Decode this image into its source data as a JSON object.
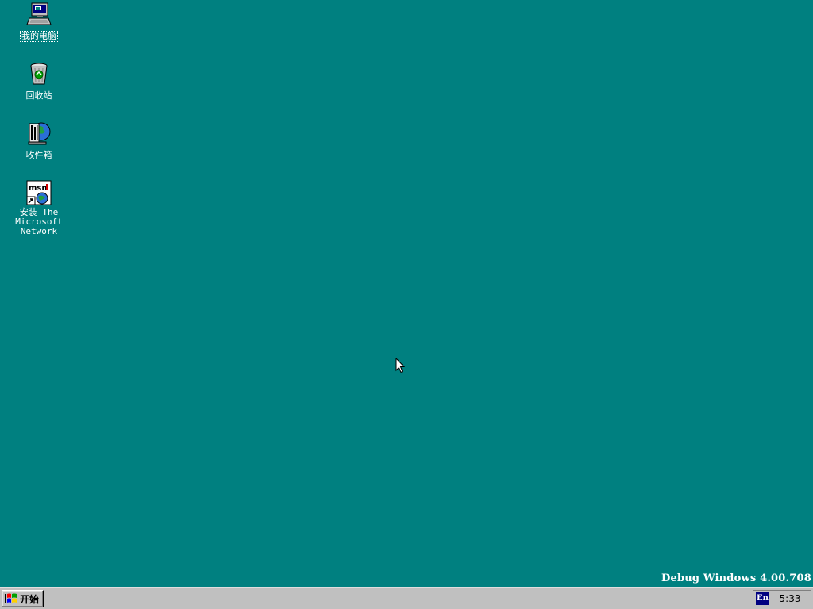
{
  "desktop": {
    "background_color": "#008080",
    "icons": [
      {
        "id": "my-computer",
        "label": "我的电脑",
        "icon": "computer-icon",
        "selected": true
      },
      {
        "id": "recycle-bin",
        "label": "回收站",
        "icon": "recycle-bin-icon",
        "selected": false
      },
      {
        "id": "inbox",
        "label": "收件箱",
        "icon": "inbox-icon",
        "selected": false
      },
      {
        "id": "msn-setup",
        "label": "安装 The\nMicrosoft\nNetwork",
        "icon": "msn-shortcut-icon",
        "selected": false
      }
    ],
    "build_stamp": "Debug Windows 4.00.708",
    "cursor": "arrow-cursor-icon"
  },
  "taskbar": {
    "background_color": "#c0c0c0",
    "start_button": {
      "label": "开始",
      "icon": "windows-logo-icon"
    },
    "tray": {
      "language_indicator": "En",
      "language_color": "#000080",
      "clock": "5:33"
    }
  }
}
